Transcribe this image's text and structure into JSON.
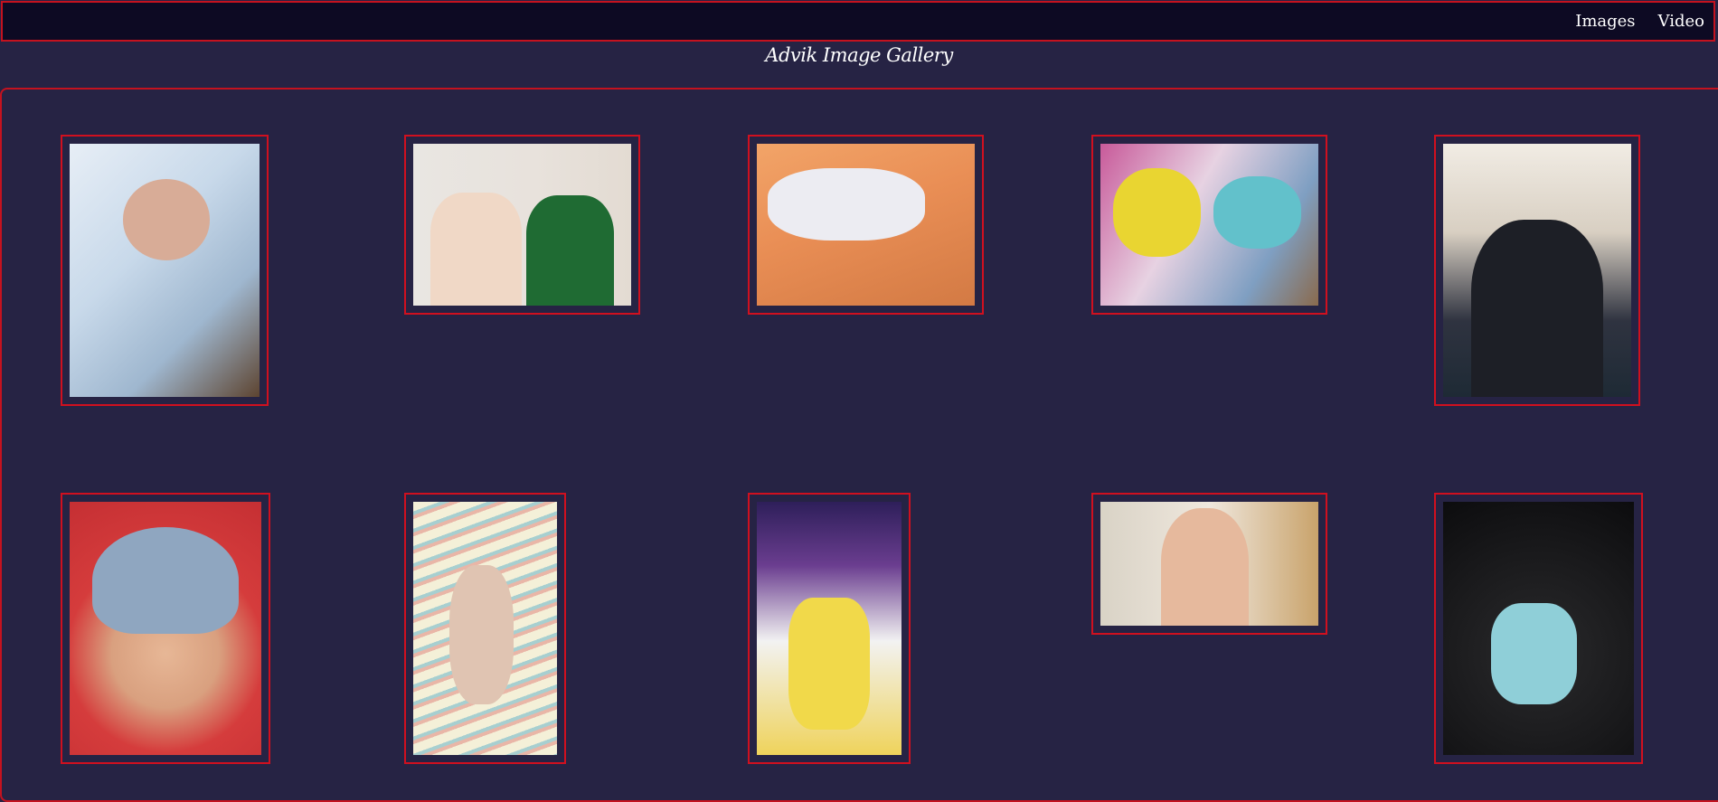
{
  "nav": {
    "links": [
      "Images",
      "Video"
    ]
  },
  "page": {
    "title": "Advik Image Gallery"
  },
  "gallery": {
    "photos": [
      {
        "subject": "newborn-wrapped-in-blanket"
      },
      {
        "subject": "parents-holding-newborn"
      },
      {
        "subject": "baby-on-orange-blanket"
      },
      {
        "subject": "children-with-baby"
      },
      {
        "subject": "man-holding-baby"
      },
      {
        "subject": "baby-with-hat-on-red-sheet"
      },
      {
        "subject": "baby-in-hammock"
      },
      {
        "subject": "baby-in-yellow-outfit"
      },
      {
        "subject": "baby-sitting-on-floor"
      },
      {
        "subject": "baby-on-black-sofa"
      }
    ]
  },
  "colors": {
    "background": "#262344",
    "navbar": "#0d0a23",
    "border": "#c4121f",
    "text": "#ffffff"
  }
}
